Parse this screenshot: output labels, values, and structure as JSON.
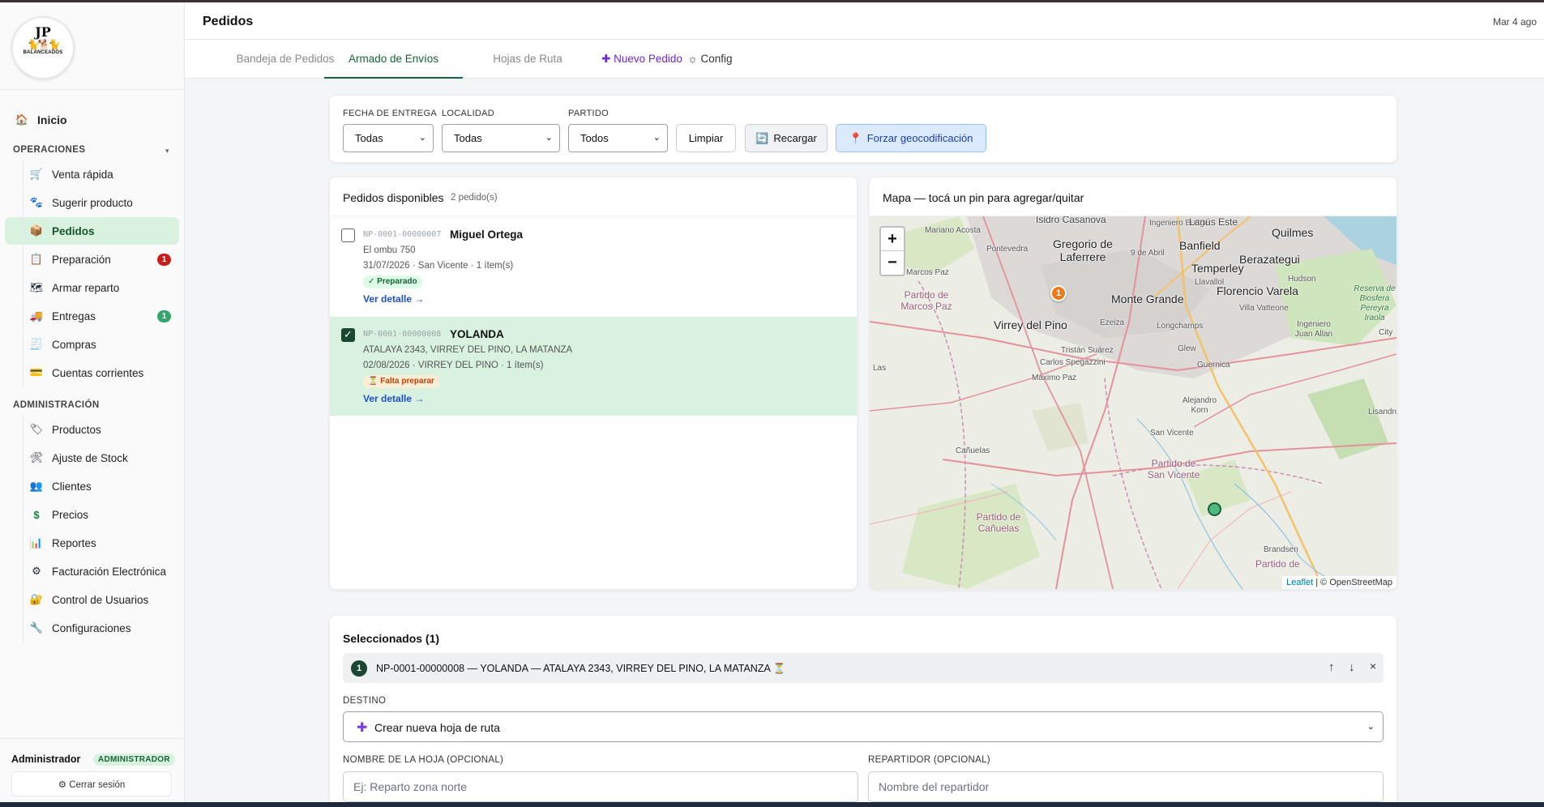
{
  "app": {
    "logo_text": "JP",
    "logo_sub": "BALANCEADOS"
  },
  "sidebar": {
    "home": {
      "icon": "house-icon",
      "label": "Inicio"
    },
    "sections": [
      {
        "title": "OPERACIONES",
        "items": [
          {
            "icon": "cart-icon",
            "label": "Venta rápida"
          },
          {
            "icon": "paw-icon",
            "label": "Sugerir producto"
          },
          {
            "icon": "box-icon",
            "label": "Pedidos",
            "active": true
          },
          {
            "icon": "clipboard-icon",
            "label": "Preparación",
            "badge": "1"
          },
          {
            "icon": "map-icon",
            "label": "Armar reparto"
          },
          {
            "icon": "truck-icon",
            "label": "Entregas",
            "badge": "1"
          },
          {
            "icon": "receipt-icon",
            "label": "Compras"
          },
          {
            "icon": "card-icon",
            "label": "Cuentas corrientes"
          }
        ]
      },
      {
        "title": "ADMINISTRACIÓN",
        "items": [
          {
            "icon": "tag-icon",
            "label": "Productos"
          },
          {
            "icon": "tools-icon",
            "label": "Ajuste de Stock"
          },
          {
            "icon": "users-icon",
            "label": "Clientes"
          },
          {
            "icon": "dollar-icon",
            "label": "Precios"
          },
          {
            "icon": "chart-icon",
            "label": "Reportes"
          },
          {
            "icon": "gear-icon",
            "label": "Facturación Electrónica"
          },
          {
            "icon": "lock-icon",
            "label": "Control de Usuarios"
          },
          {
            "icon": "wrench-icon",
            "label": "Configuraciones"
          }
        ]
      }
    ],
    "user": {
      "name": "Administrador",
      "role": "ADMINISTRADOR",
      "logout": "⚙ Cerrar sesión"
    }
  },
  "header": {
    "title": "Pedidos",
    "date": "Mar 4 ago"
  },
  "tabs": [
    {
      "label": "Bandeja de Pedidos"
    },
    {
      "label": "Armado de Envíos",
      "active": true
    },
    {
      "label": "Hojas de Ruta"
    },
    {
      "label": "✚ Nuevo Pedido"
    },
    {
      "label": "☼ Config"
    }
  ],
  "filters": {
    "fecha_label": "FECHA DE ENTREGA",
    "fecha_value": "Todas",
    "localidad_label": "LOCALIDAD",
    "localidad_value": "Todas",
    "partido_label": "PARTIDO",
    "partido_value": "Todos",
    "limpiar": "Limpiar",
    "recargar": "Recargar",
    "geocode": "Forzar geocodificación"
  },
  "orders_panel": {
    "title": "Pedidos disponibles",
    "count": "2 pedido(s)",
    "orders": [
      {
        "code": "NP-0001-00000007",
        "name": "Miguel Ortega",
        "address": "El ombu 750",
        "meta": "31/07/2026 · San Vicente · 1 ítem(s)",
        "status": "✓ Preparado",
        "link": "Ver detalle →",
        "checked": false
      },
      {
        "code": "NP-0001-00000008",
        "name": "YOLANDA",
        "address": "ATALAYA 2343, VIRREY DEL PINO, LA MATANZA",
        "meta": "02/08/2026 · VIRREY DEL PINO · 1 ítem(s)",
        "status": "⏳ Falta preparar",
        "link": "Ver detalle →",
        "checked": true
      }
    ]
  },
  "map": {
    "title": "Mapa — tocá un pin para agregar/quitar",
    "zoom_in": "+",
    "zoom_out": "−",
    "attribution_leaflet": "Leaflet",
    "attribution_osm": "| © OpenStreetMap",
    "pin_label": "1",
    "labels": {
      "isidro": "Isidro Casanova",
      "ingeniero_budge": "Ingeniero Budge",
      "lanus": "Lanús Este",
      "quilmes": "Quilmes",
      "mariano": "Mariano Acosta",
      "pontevedra": "Pontevedra",
      "gregorio": "Gregorio de Laferrere",
      "abril": "9 de Abril",
      "banfield": "Banfield",
      "temperley": "Temperley",
      "berazategui": "Berazategui",
      "marcos": "Marcos Paz",
      "llavallol": "Llavallol",
      "hudson": "Hudson",
      "partido_marcos": "Partido de Marcos Paz",
      "monte": "Monte Grande",
      "florencio": "Florencio Varela",
      "reserva": "Reserva de Biosfera Pereyra Iraola",
      "villa_vatteone": "Villa Vatteone",
      "virrey": "Virrey del Pino",
      "ezeiza": "Ezeiza",
      "longchamps": "Longchamps",
      "ing_allan": "Ingeniero Juan Allan",
      "city": "City",
      "tristan": "Tristán Suárez",
      "glew": "Glew",
      "carlos": "Carlos Spegazzini",
      "guernica": "Guernica",
      "las": "Las",
      "maximo": "Máximo Paz",
      "alejandro": "Alejandro Korn",
      "lisandro": "Lisandro",
      "san_vicente": "San Vicente",
      "canuelas": "Cañuelas",
      "partido_sv": "Partido de San Vicente",
      "partido_can": "Partido de Cañuelas",
      "brandsen": "Brandsen",
      "partido_de": "Partido de"
    }
  },
  "selected": {
    "title": "Seleccionados (1)",
    "row_num": "1",
    "row_text": "NP-0001-00000008 — YOLANDA — ATALAYA 2343, VIRREY DEL PINO, LA MATANZA ⏳",
    "up": "↑",
    "down": "↓",
    "remove": "×",
    "destino_label": "DESTINO",
    "destino_value": "Crear nueva hoja de ruta",
    "nombre_label": "NOMBRE DE LA HOJA (OPCIONAL)",
    "nombre_placeholder": "Ej: Reparto zona norte",
    "repartidor_label": "REPARTIDOR (OPCIONAL)",
    "repartidor_placeholder": "Nombre del repartidor"
  }
}
